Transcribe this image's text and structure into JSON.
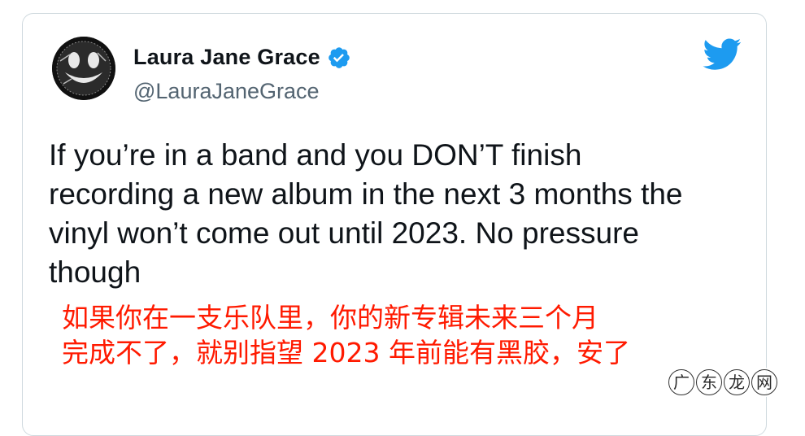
{
  "author": {
    "display_name": "Laura Jane Grace",
    "handle": "@LauraJaneGrace",
    "verified": true,
    "avatar_icon": "smiley-face-avatar"
  },
  "brand": {
    "icon": "twitter-bird-icon",
    "color": "#1d9bf0"
  },
  "tweet": {
    "text": "If you’re in a band and you DON’T finish\nrecording a new album in the next 3 months the\nvinyl won’t come out until 2023. No pressure\nthough"
  },
  "translation": {
    "text": "如果你在一支乐队里，你的新专辑未来三个月\n完成不了，就别指望 2023 年前能有黑胶，安了",
    "color": "#ff1a00"
  },
  "watermark": {
    "chars": [
      "广",
      "东",
      "龙",
      "网"
    ]
  },
  "colors": {
    "name": "#0f1419",
    "handle": "#536471",
    "verified": "#1d9bf0",
    "border": "#cfd9de"
  }
}
